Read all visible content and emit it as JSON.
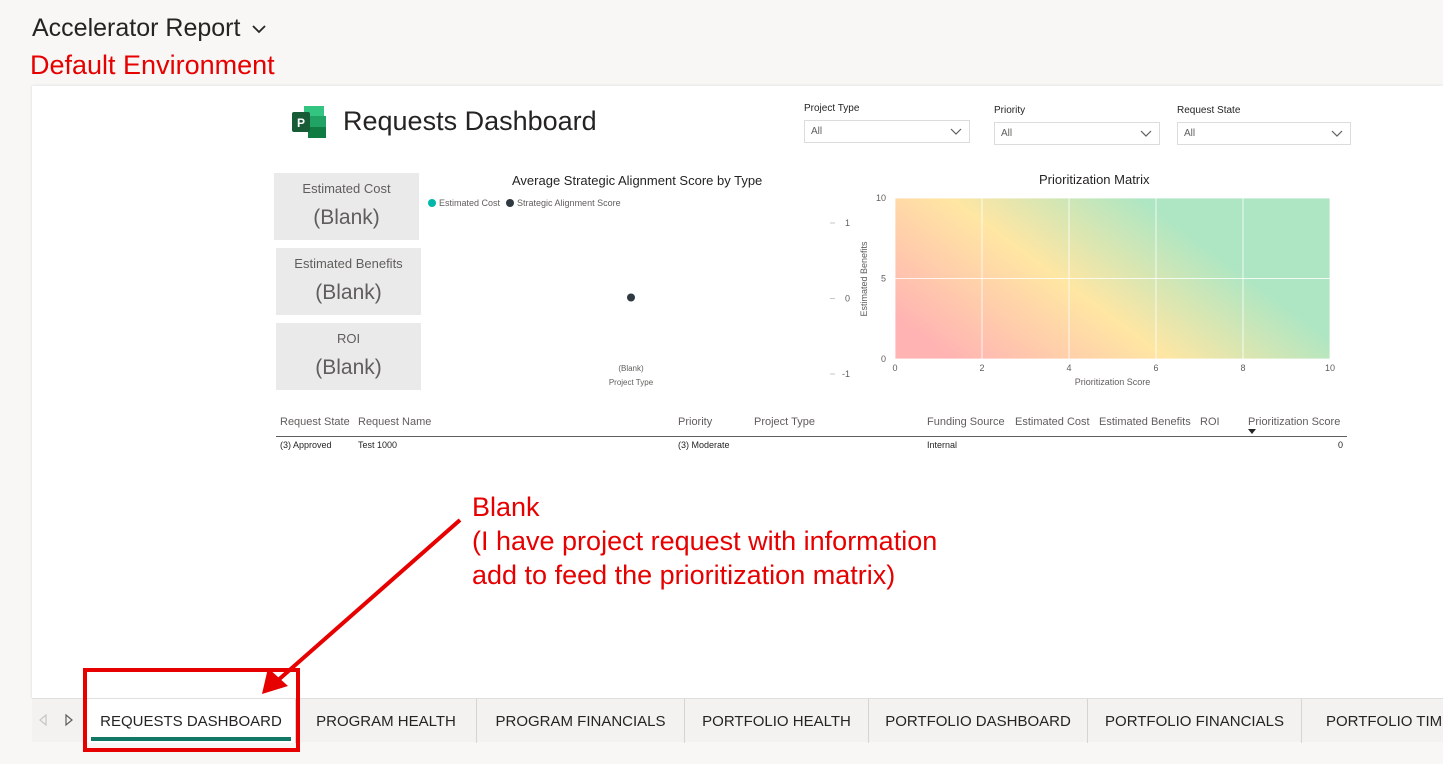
{
  "app": {
    "title": "Accelerator Report",
    "environment": "Default Environment"
  },
  "report": {
    "title": "Requests Dashboard"
  },
  "slicers": [
    {
      "label": "Project Type",
      "value": "All"
    },
    {
      "label": "Priority",
      "value": "All"
    },
    {
      "label": "Request State",
      "value": "All"
    }
  ],
  "cards": [
    {
      "title": "Estimated Cost",
      "value": "(Blank)"
    },
    {
      "title": "Estimated Benefits",
      "value": "(Blank)"
    },
    {
      "title": "ROI",
      "value": "(Blank)"
    }
  ],
  "chart_data": [
    {
      "type": "scatter",
      "title": "Average Strategic Alignment Score by Type",
      "legend": [
        {
          "name": "Estimated Cost",
          "color": "#00b7a8"
        },
        {
          "name": "Strategic Alignment Score",
          "color": "#2e3a3f"
        }
      ],
      "legend_placement": "top-left",
      "categories": [
        "(Blank)"
      ],
      "series": [
        {
          "name": "Strategic Alignment Score",
          "values": [
            0
          ]
        }
      ],
      "xlabel": "Project Type",
      "ylabel": "",
      "yticks": [
        "1",
        "0",
        "-1"
      ],
      "ylim": [
        -1,
        1
      ]
    },
    {
      "type": "heatmap",
      "title": "Prioritization Matrix",
      "xlabel": "Prioritization Score",
      "ylabel": "Estimated Benefits",
      "xticks": [
        "0",
        "2",
        "4",
        "6",
        "8",
        "10"
      ],
      "yticks": [
        "10",
        "5",
        "0"
      ],
      "xlim": [
        0,
        10
      ],
      "ylim": [
        0,
        10
      ],
      "gradient_colors": [
        "#ffb3b3",
        "#ffe6a3",
        "#aee6c3"
      ],
      "grid": true
    }
  ],
  "table": {
    "headers": [
      "Request State",
      "Request Name",
      "Priority",
      "Project Type",
      "Funding Source",
      "Estimated Cost",
      "Estimated Benefits",
      "ROI",
      "Prioritization Score"
    ],
    "rows": [
      [
        "(3) Approved",
        "Test 1000",
        "(3) Moderate",
        "",
        "Internal",
        "",
        "",
        "",
        "0"
      ]
    ]
  },
  "annotation": {
    "lines": [
      "Blank",
      "(I have project request with information",
      "add to feed the prioritization matrix)"
    ],
    "color": "#e60000"
  },
  "tabs": [
    {
      "label": "REQUESTS DASHBOARD",
      "active": true
    },
    {
      "label": "PROGRAM HEALTH"
    },
    {
      "label": "PROGRAM FINANCIALS"
    },
    {
      "label": "PORTFOLIO HEALTH"
    },
    {
      "label": "PORTFOLIO DASHBOARD"
    },
    {
      "label": "PORTFOLIO FINANCIALS"
    },
    {
      "label": "PORTFOLIO TIMELINE"
    }
  ],
  "icons": {
    "title_dropdown": "chevron-down-icon",
    "report_logo": "project-logo-icon",
    "nav_prev": "triangle-left-icon",
    "nav_next": "triangle-right-icon"
  }
}
